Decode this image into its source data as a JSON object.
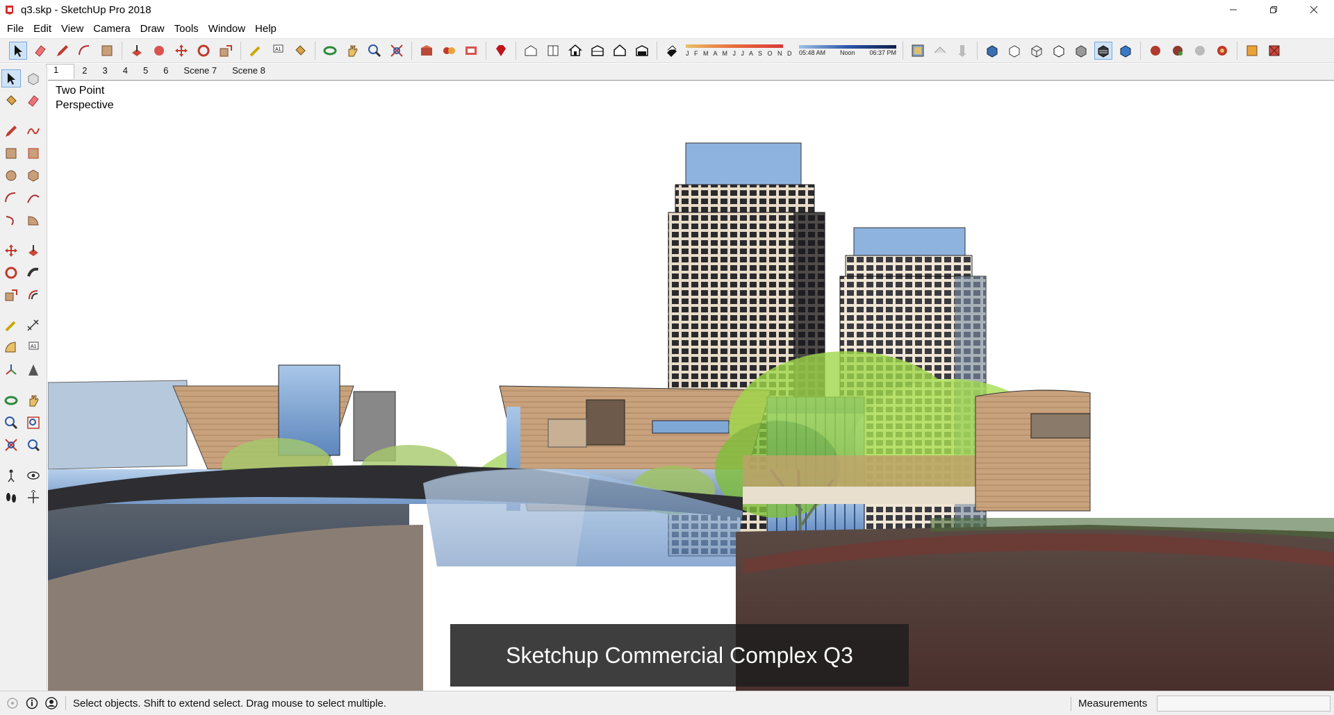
{
  "window": {
    "title": "q3.skp - SketchUp Pro 2018",
    "controls": [
      "minimize",
      "restore",
      "close"
    ]
  },
  "menu": [
    "File",
    "Edit",
    "View",
    "Camera",
    "Draw",
    "Tools",
    "Window",
    "Help"
  ],
  "shadow_settings": {
    "months": "J F M A M J J A S O N D",
    "time_start": "05:48 AM",
    "time_mid": "Noon",
    "time_end": "06:37 PM"
  },
  "scenes": {
    "tabs": [
      "1",
      "2",
      "3",
      "4",
      "5",
      "6",
      "Scene 7",
      "Scene 8"
    ],
    "active": "1"
  },
  "viewport": {
    "camera_label_line1": "Two Point",
    "camera_label_line2": "Perspective",
    "caption": "Sketchup Commercial Complex Q3"
  },
  "status": {
    "text": "Select objects. Shift to extend select. Drag mouse to select multiple.",
    "measurements_label": "Measurements",
    "measurements_value": ""
  },
  "colors": {
    "accent": "#2b56a8",
    "sky": "#ffffff",
    "glass": "#7fa8d6",
    "tree": "#8fce3a"
  }
}
